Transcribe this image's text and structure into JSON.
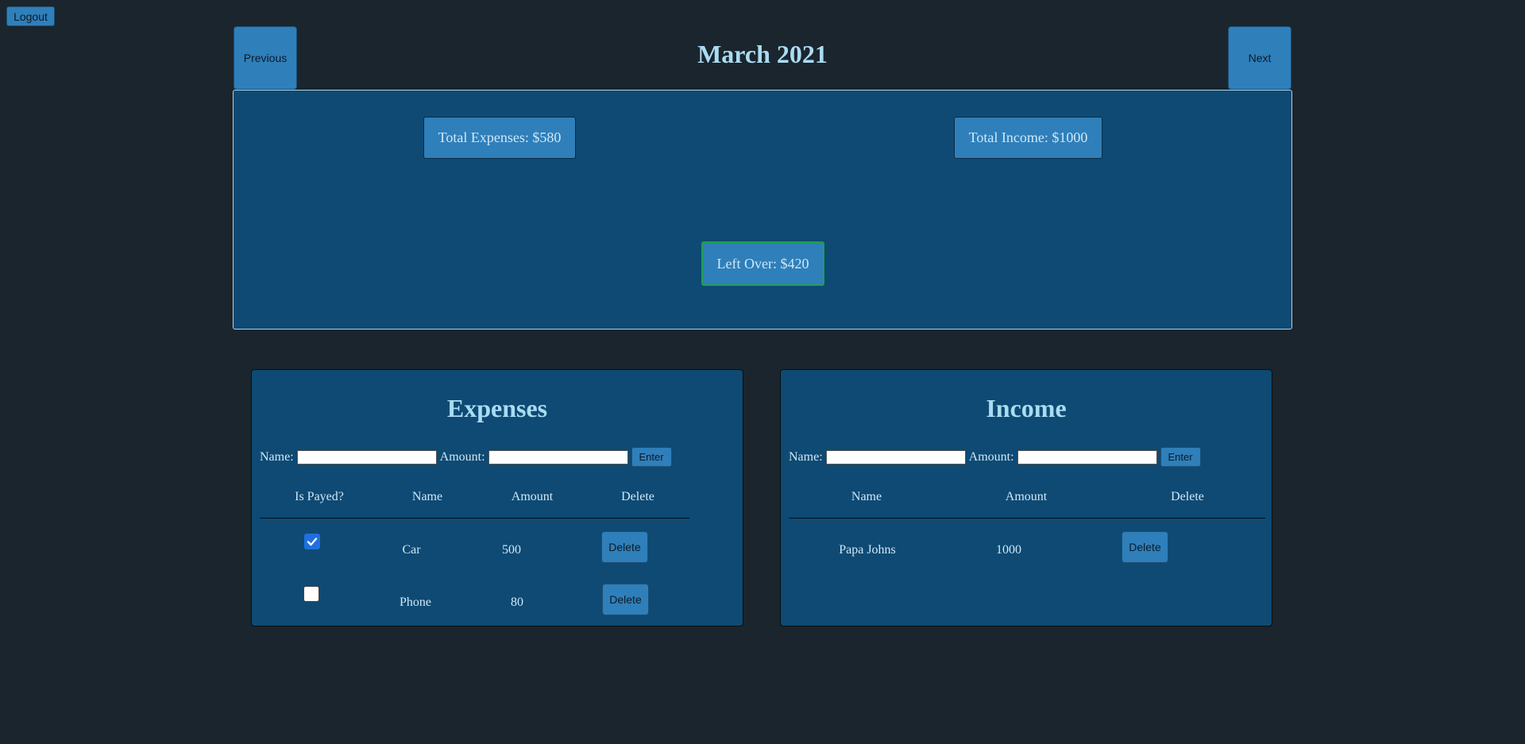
{
  "header": {
    "logout_label": "Logout",
    "previous_label": "Previous",
    "next_label": "Next",
    "month_title": "March 2021"
  },
  "summary": {
    "total_expenses": "Total Expenses: $580",
    "total_income": "Total Income: $1000",
    "left_over": "Left Over: $420"
  },
  "expenses": {
    "title": "Expenses",
    "name_label": "Name:",
    "amount_label": "Amount:",
    "name_value": "",
    "amount_value": "",
    "enter_label": "Enter",
    "columns": [
      "Is Payed?",
      "Name",
      "Amount",
      "Delete"
    ],
    "rows": [
      {
        "payed": true,
        "name": "Car",
        "amount": "500",
        "delete_label": "Delete"
      },
      {
        "payed": false,
        "name": "Phone",
        "amount": "80",
        "delete_label": "Delete"
      }
    ]
  },
  "income": {
    "title": "Income",
    "name_label": "Name:",
    "amount_label": "Amount:",
    "name_value": "",
    "amount_value": "",
    "enter_label": "Enter",
    "columns": [
      "Name",
      "Amount",
      "Delete"
    ],
    "rows": [
      {
        "name": "Papa Johns",
        "amount": "1000",
        "delete_label": "Delete"
      }
    ]
  },
  "colors": {
    "page_bg": "#1b252d",
    "panel_bg": "#0e4a73",
    "button_bg": "#2f7fba",
    "title_text": "#a9dcf2",
    "left_over_border": "#1fa04a",
    "checkbox_checked": "#1f6fe0"
  }
}
